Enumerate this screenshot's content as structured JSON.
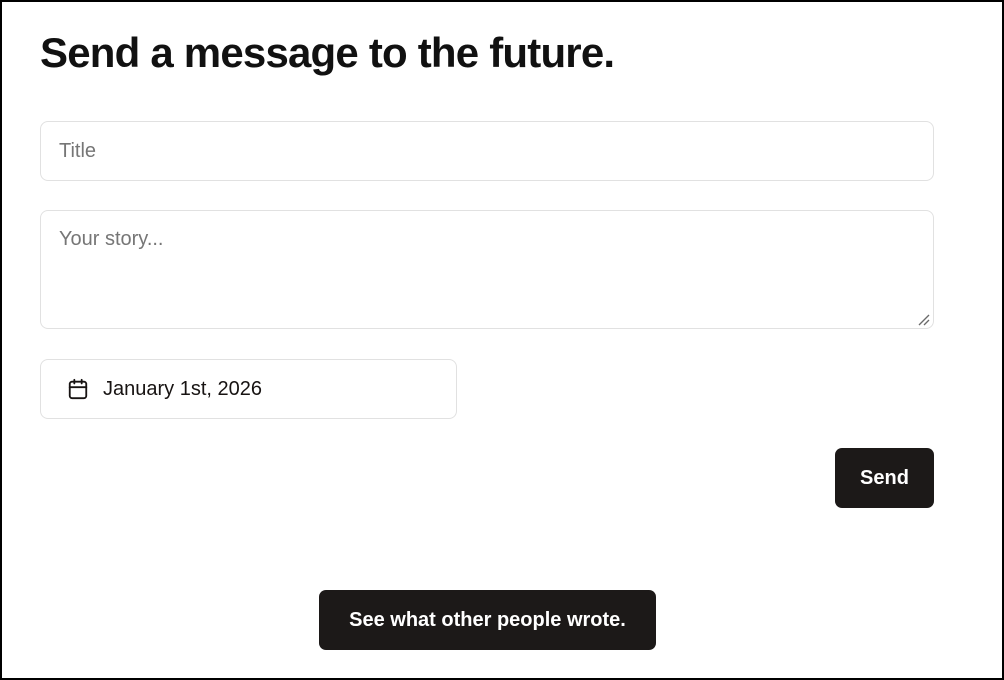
{
  "page": {
    "title": "Send a message to the future."
  },
  "form": {
    "title_placeholder": "Title",
    "title_value": "",
    "story_placeholder": "Your story...",
    "story_value": "",
    "date_icon": "calendar-icon",
    "date_value": "January 1st, 2026"
  },
  "actions": {
    "send_label": "Send",
    "see_others_label": "See what other people wrote."
  },
  "colors": {
    "button_bg": "#1c1918",
    "button_text": "#ffffff",
    "field_border": "#e1e1e1",
    "placeholder": "#767676",
    "text": "#171312"
  }
}
